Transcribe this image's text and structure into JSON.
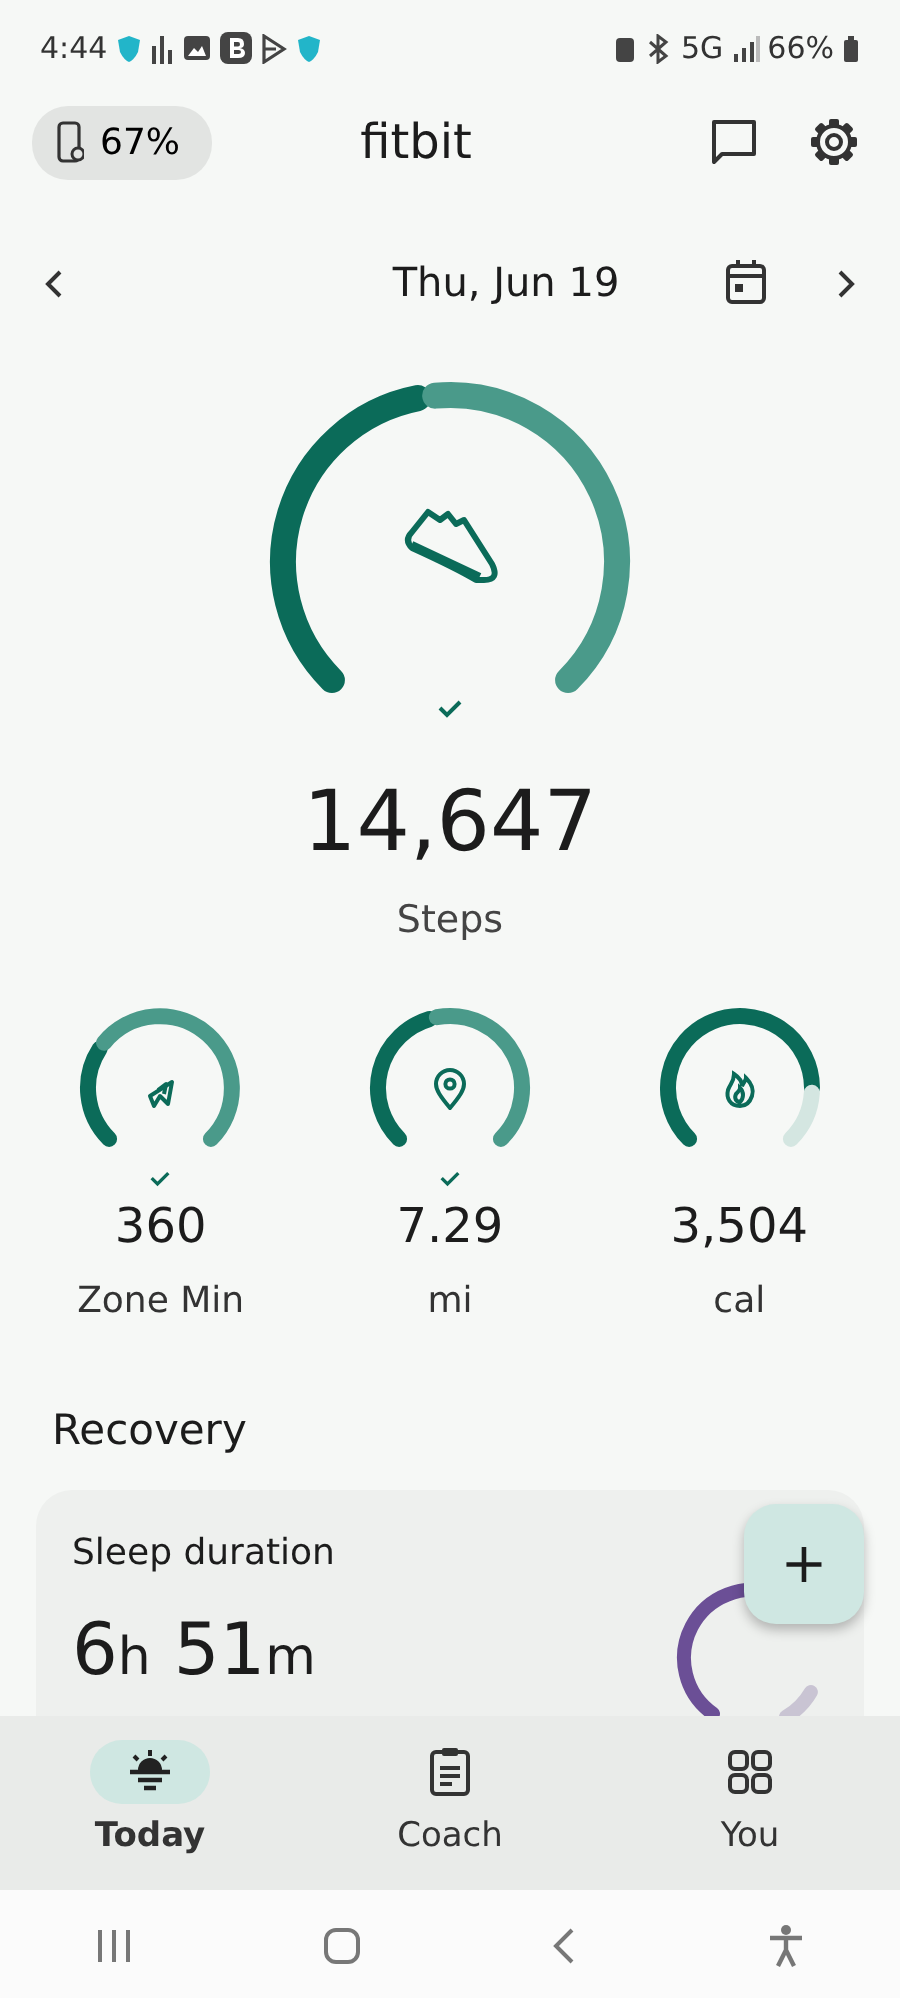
{
  "status_bar": {
    "time": "4:44",
    "battery": "66%",
    "network": "5G"
  },
  "header": {
    "watch_battery": "67%",
    "title": "fitbit"
  },
  "date_nav": {
    "date": "Thu, Jun 19"
  },
  "main_stat": {
    "value": "14,647",
    "label": "Steps",
    "goal_met": true
  },
  "stats": [
    {
      "kind": "zone",
      "value": "360",
      "label": "Zone Min",
      "goal_met": true
    },
    {
      "kind": "distance",
      "value": "7.29",
      "label": "mi",
      "goal_met": true
    },
    {
      "kind": "calories",
      "value": "3,504",
      "label": "cal",
      "goal_met": false
    }
  ],
  "section_title": "Recovery",
  "sleep_card": {
    "title": "Sleep duration",
    "hours": "6",
    "hours_unit": "h",
    "minutes": "51",
    "minutes_unit": "m"
  },
  "fab": {
    "label": "+"
  },
  "tabs": [
    {
      "label": "Today",
      "selected": true
    },
    {
      "label": "Coach",
      "selected": false
    },
    {
      "label": "You",
      "selected": false
    }
  ]
}
